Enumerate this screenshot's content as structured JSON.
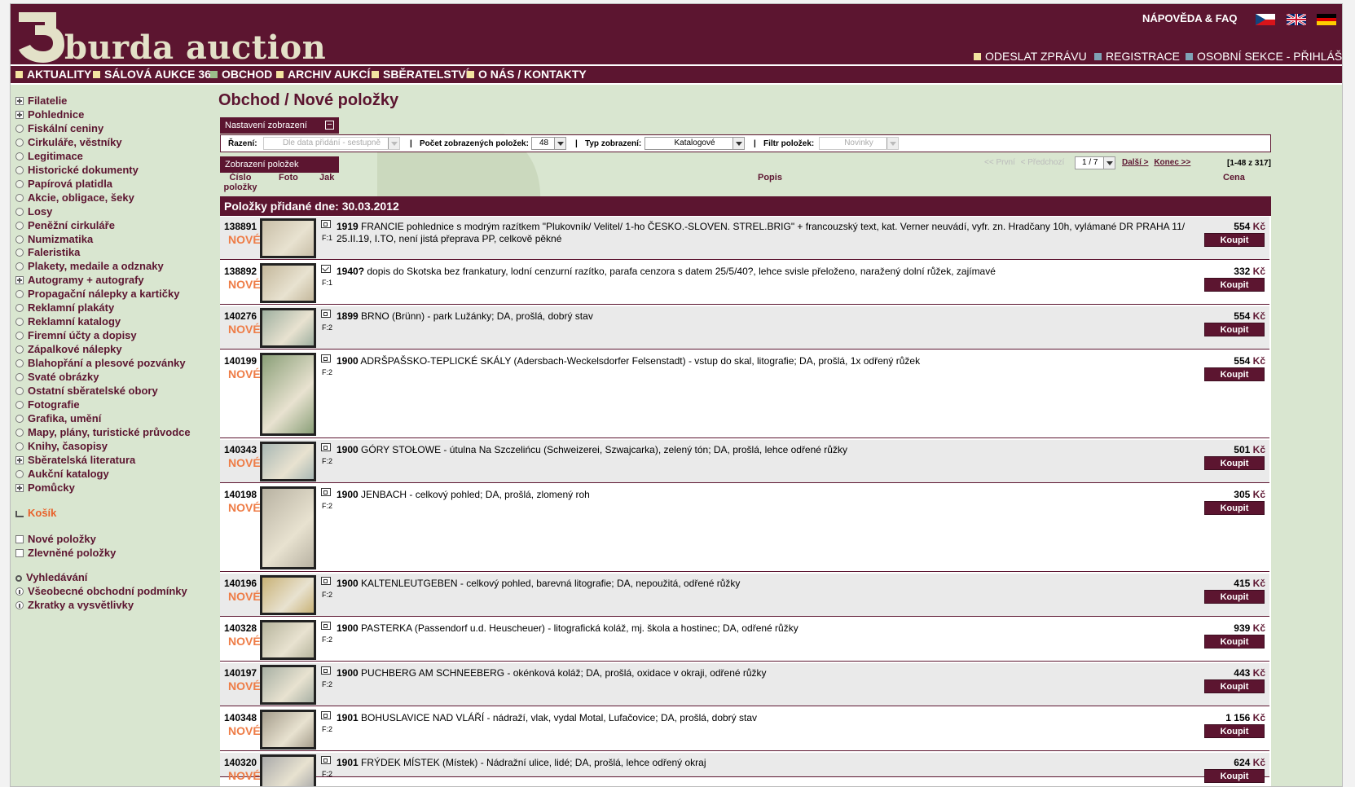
{
  "brand": {
    "name": "burda auction",
    "colors": {
      "primary": "#5c1530",
      "menu_bg": "#d9e6d0",
      "accent_new": "#ee7c46"
    }
  },
  "header": {
    "help": "NÁPOVĚDA & FAQ",
    "flags": [
      "flag-cz-icon",
      "flag-en-icon",
      "flag-de-icon"
    ],
    "links": {
      "message": "ODESLAT ZPRÁVU",
      "registration": "REGISTRACE",
      "login": "OSOBNÍ SEKCE - PŘIHLÁŠENÍ"
    }
  },
  "nav": [
    "AKTUALITY",
    "SÁLOVÁ AUKCE 36",
    "OBCHOD",
    "ARCHIV AUKCÍ",
    "SBĚRATELSTVÍ",
    "O NÁS / KONTAKTY"
  ],
  "sidebar": {
    "categories": [
      {
        "label": "Filatelie",
        "icon": "plus"
      },
      {
        "label": "Pohlednice",
        "icon": "plus"
      },
      {
        "label": "Fiskální ceniny",
        "icon": "circle"
      },
      {
        "label": "Cirkuláře, věstníky",
        "icon": "circle"
      },
      {
        "label": "Legitimace",
        "icon": "circle"
      },
      {
        "label": "Historické dokumenty",
        "icon": "circle"
      },
      {
        "label": "Papírová platidla",
        "icon": "circle"
      },
      {
        "label": "Akcie, obligace, šeky",
        "icon": "circle"
      },
      {
        "label": "Losy",
        "icon": "circle"
      },
      {
        "label": "Peněžní cirkuláře",
        "icon": "circle"
      },
      {
        "label": "Numizmatika",
        "icon": "circle"
      },
      {
        "label": "Faleristika",
        "icon": "circle"
      },
      {
        "label": "Plakety, medaile a odznaky",
        "icon": "circle"
      },
      {
        "label": "Autogramy + autografy",
        "icon": "plus"
      },
      {
        "label": "Propagační nálepky a kartičky",
        "icon": "circle"
      },
      {
        "label": "Reklamní plakáty",
        "icon": "circle"
      },
      {
        "label": "Reklamní katalogy",
        "icon": "circle"
      },
      {
        "label": "Firemní účty a dopisy",
        "icon": "circle"
      },
      {
        "label": "Zápalkové nálepky",
        "icon": "circle"
      },
      {
        "label": "Blahopřání a plesové pozvánky",
        "icon": "circle"
      },
      {
        "label": "Svaté obrázky",
        "icon": "circle"
      },
      {
        "label": "Ostatní sběratelské obory",
        "icon": "circle"
      },
      {
        "label": "Fotografie",
        "icon": "circle"
      },
      {
        "label": "Grafika, umění",
        "icon": "circle"
      },
      {
        "label": "Mapy, plány, turistické průvodce",
        "icon": "circle"
      },
      {
        "label": "Knihy, časopisy",
        "icon": "circle"
      },
      {
        "label": "Sběratelská literatura",
        "icon": "plus"
      },
      {
        "label": "Aukční katalogy",
        "icon": "circle"
      },
      {
        "label": "Pomůcky",
        "icon": "plus"
      }
    ],
    "cart": "Košík",
    "new_items": "Nové položky",
    "discounted": "Zlevněné položky",
    "search": "Vyhledávání",
    "terms": "Všeobecné obchodní podmínky",
    "abbrev": "Zkratky a vysvětlivky"
  },
  "main": {
    "title": "Obchod / Nové položky",
    "settings_tab": "Nastavení zobrazení",
    "settings": {
      "sort_label": "Řazení:",
      "sort_value": "Dle data přidání - sestupně",
      "count_label": "Počet zobrazených položek:",
      "count_value": "48",
      "view_label": "Typ zobrazení:",
      "view_value": "Katalogové",
      "filter_label": "Filtr položek:",
      "filter_value": "Novinky"
    },
    "items_tab": "Zobrazení položek",
    "pager": {
      "first": "<< První",
      "prev": "< Předchozí",
      "page": "1 / 7",
      "next": "Další >",
      "last": "Konec >>",
      "range": "[1-48 z 317]"
    },
    "columns": {
      "number": "Číslo položky",
      "photo": "Foto",
      "kind": "Jak",
      "description": "Popis",
      "price": "Cena"
    },
    "day_header": "Položky přidané dne: 30.03.2012",
    "new_label": "NOVÉ",
    "buy_label": "Koupit",
    "currency": "Kč",
    "items": [
      {
        "num": "138891",
        "year": "1919",
        "desc": "FRANCIE pohlednice s modrým razítkem \"Plukovník/ Velitel/ 1-ho ČESKO.-SLOVEN. STREL.BRIG\" + francouzský text, kat. Verner neuvádí, vyfr. zn. Hradčany 10h, vylámané DR PRAHA 11/ 25.II.19, I.TO, není jistá přeprava PP, celkově pěkné",
        "price": "554",
        "f": "F:1",
        "kind": "card"
      },
      {
        "num": "138892",
        "year": "1940?",
        "desc": "dopis do Skotska bez frankatury, lodní cenzurní razítko, parafa cenzora s datem 25/5/40?, lehce svisle přeloženo, naražený dolní růžek, zajímavé",
        "price": "332",
        "f": "F:1",
        "kind": "letter"
      },
      {
        "num": "140276",
        "year": "1899",
        "desc": "BRNO (Brünn) - park Lužánky; DA, prošlá, dobrý stav",
        "price": "554",
        "f": "F:2",
        "kind": "card"
      },
      {
        "num": "140199",
        "year": "1900",
        "desc": "ADRŠPAŠSKO-TEPLICKÉ SKÁLY (Adersbach-Weckelsdorfer Felsenstadt) - vstup do skal, litografie; DA, prošlá, 1x odřený růžek",
        "price": "554",
        "f": "F:2",
        "kind": "card"
      },
      {
        "num": "140343",
        "year": "1900",
        "desc": "GÓRY STOŁOWE - útulna Na Szczelińcu (Schweizerei, Szwajcarka), zelený tón; DA, prošlá, lehce odřené růžky",
        "price": "501",
        "f": "F:2",
        "kind": "card"
      },
      {
        "num": "140198",
        "year": "1900",
        "desc": "JENBACH - celkový pohled; DA, prošlá, zlomený roh",
        "price": "305",
        "f": "F:2",
        "kind": "card"
      },
      {
        "num": "140196",
        "year": "1900",
        "desc": "KALTENLEUTGEBEN - celkový pohled, barevná litografie; DA, nepoužitá, odřené růžky",
        "price": "415",
        "f": "F:2",
        "kind": "card"
      },
      {
        "num": "140328",
        "year": "1900",
        "desc": "PASTERKA (Passendorf u.d. Heuscheuer) - litografická koláž, mj. škola a hostinec; DA, odřené růžky",
        "price": "939",
        "f": "F:2",
        "kind": "card"
      },
      {
        "num": "140197",
        "year": "1900",
        "desc": "PUCHBERG AM SCHNEEBERG - okénková koláž; DA, prošlá, oxidace v okraji, odřené růžky",
        "price": "443",
        "f": "F:2",
        "kind": "card"
      },
      {
        "num": "140348",
        "year": "1901",
        "desc": "BOHUSLAVICE NAD VLÁŘÍ - nádraží, vlak, vydal Motal, Lufačovice; DA, prošlá, dobrý stav",
        "price": "1 156",
        "f": "F:2",
        "kind": "card"
      },
      {
        "num": "140320",
        "year": "1901",
        "desc": "FRÝDEK MÍSTEK (Místek) - Nádražní ulice, lidé; DA, prošlá, lehce odřený okraj",
        "price": "624",
        "f": "F:2",
        "kind": "card"
      }
    ]
  }
}
